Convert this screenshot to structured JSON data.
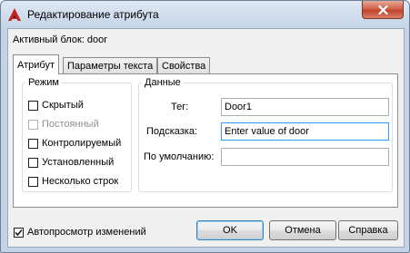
{
  "window": {
    "title": "Редактирование атрибута"
  },
  "active_block": "Активный блок: door",
  "tabs": [
    {
      "label": "Атрибут",
      "active": true
    },
    {
      "label": "Параметры текста",
      "active": false
    },
    {
      "label": "Свойства",
      "active": false
    }
  ],
  "mode": {
    "title": "Режим",
    "items": [
      {
        "label": "Скрытый",
        "checked": false,
        "enabled": true
      },
      {
        "label": "Постоянный",
        "checked": false,
        "enabled": false
      },
      {
        "label": "Контролируемый",
        "checked": false,
        "enabled": true
      },
      {
        "label": "Установленный",
        "checked": false,
        "enabled": true
      },
      {
        "label": "Несколько строк",
        "checked": false,
        "enabled": true
      }
    ]
  },
  "data": {
    "title": "Данные",
    "tag_label": "Тег:",
    "tag_value": "Door1",
    "prompt_label": "Подсказка:",
    "prompt_value": "Enter value of door",
    "default_label": "По умолчанию:",
    "default_value": ""
  },
  "auto_preview": {
    "label": "Автопросмотр изменений",
    "checked": true
  },
  "buttons": {
    "ok": "OK",
    "cancel": "Отмена",
    "help": "Справка"
  },
  "icons": {
    "app": "autocad-a-icon",
    "close": "close-icon"
  },
  "colors": {
    "close_button": "#c2442a",
    "app_icon": "#c8231b",
    "focus_border": "#3399ff"
  }
}
